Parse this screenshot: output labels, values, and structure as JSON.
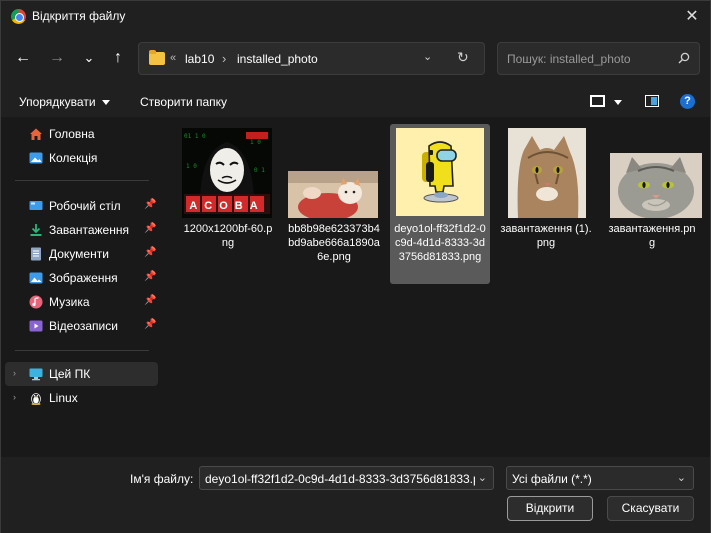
{
  "window": {
    "title": "Відкриття файлу",
    "close_glyph": "✕"
  },
  "nav": {
    "back": "←",
    "forward": "→",
    "recent": "⌄",
    "up": "↑",
    "breadcrumb_sep": "«",
    "arrow": "›",
    "crumbs": [
      "lab10",
      "installed_photo"
    ],
    "dropdown": "⌄",
    "refresh": "↻"
  },
  "search": {
    "placeholder": "Пошук: installed_photo"
  },
  "toolbar": {
    "sort_label": "Упорядкувати",
    "new_folder_label": "Створити папку",
    "help": "?"
  },
  "sidebar": {
    "items": [
      {
        "label": "Головна",
        "icon": "home-icon",
        "color": "#e8623a"
      },
      {
        "label": "Колекція",
        "icon": "gallery-icon",
        "color": "#3d9be9"
      },
      {
        "label": "Робочий стіл",
        "icon": "desktop-icon",
        "color": "#3d9be9",
        "pinned": true
      },
      {
        "label": "Завантаження",
        "icon": "download-icon",
        "color": "#2fb37a",
        "pinned": true
      },
      {
        "label": "Документи",
        "icon": "documents-icon",
        "color": "#8fa7c2",
        "pinned": true
      },
      {
        "label": "Зображення",
        "icon": "pictures-icon",
        "color": "#3d9be9",
        "pinned": true
      },
      {
        "label": "Музика",
        "icon": "music-icon",
        "color": "#e8647a",
        "pinned": true
      },
      {
        "label": "Відеозаписи",
        "icon": "videos-icon",
        "color": "#8a63d2",
        "pinned": true
      },
      {
        "label": "Цей ПК",
        "icon": "this-pc-icon",
        "color": "#3db2e0"
      },
      {
        "label": "Linux",
        "icon": "linux-icon",
        "color": "#f0c020"
      }
    ]
  },
  "files": [
    {
      "name": "1200x1200bf-60.png",
      "thumb": "anonymous-mask"
    },
    {
      "name": "bb8b98e623373b4bd9abe666a1890a6e.png",
      "thumb": "kitten-blanket"
    },
    {
      "name": "deyo1ol-ff32f1d2-0c9d-4d1d-8333-3d3756d81833.png",
      "thumb": "yellow-crewmate"
    },
    {
      "name": "завантаження (1).png",
      "thumb": "tabby-cat"
    },
    {
      "name": "завантаження.png",
      "thumb": "smirking-cat"
    }
  ],
  "thumb_text": {
    "acoba": "ACOBA"
  },
  "footer": {
    "filename_label": "Ім'я файлу:",
    "filename_value": "deyo1ol-ff32f1d2-0c9d-4d1d-8333-3d3756d81833.png",
    "type_value": "Усі файли (*.*)",
    "chevron": "⌄",
    "open_label": "Відкрити",
    "cancel_label": "Скасувати"
  }
}
